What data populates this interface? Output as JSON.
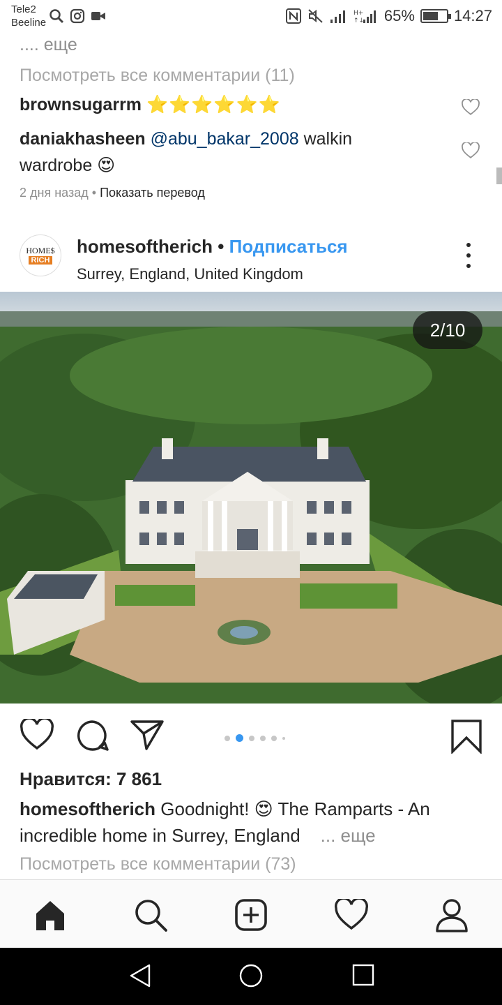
{
  "status_bar": {
    "carrier1": "Tele2",
    "carrier2": "Beeline",
    "battery_text": "65%",
    "battery_level": 0.65,
    "time": "14:27"
  },
  "previous_post": {
    "more_text": ".... еще",
    "view_all_comments": "Посмотреть все комментарии (11)",
    "comments": [
      {
        "user": "brownsugarrm",
        "text": "⭐⭐⭐⭐⭐⭐"
      },
      {
        "user": "daniakhasheen",
        "mention": "@abu_bakar_2008",
        "text": " walkin",
        "text2": "wardrobe 😍"
      }
    ],
    "time_ago": "2 дня назад",
    "translate": "Показать перевод"
  },
  "post": {
    "username": "homesoftherich",
    "separator": " • ",
    "follow_label": "Подписаться",
    "location": "Surrey, England, United Kingdom",
    "avatar_line1": "HOME$",
    "avatar_line2": "RICH",
    "counter": "2/10",
    "likes": "Нравится: 7 861",
    "caption_user": "homesoftherich",
    "caption_text": " Goodnight! 😍 The Ramparts - An incredible home in Surrey, England",
    "caption_more": "... еще",
    "view_all_comments": "Посмотреть все комментарии (73)"
  },
  "icons": {
    "like": "heart-icon",
    "comment": "comment-icon",
    "share": "send-icon",
    "save": "bookmark-icon",
    "nav": [
      "home-icon",
      "search-icon",
      "add-icon",
      "activity-heart-icon",
      "profile-icon"
    ]
  },
  "colors": {
    "link_blue": "#3897f0",
    "mention": "#003569",
    "gray_text": "#8e8e8e",
    "active_dot": "#3897f0"
  }
}
